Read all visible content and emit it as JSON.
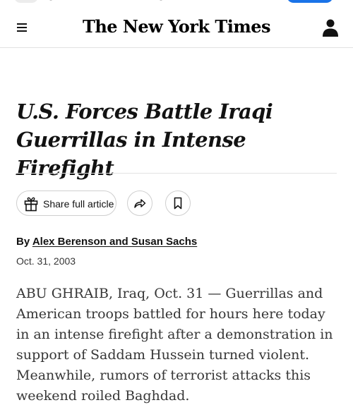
{
  "header": {
    "masthead": "The New York Times",
    "menu_icon": "hamburger-menu-icon",
    "account_icon": "person-icon"
  },
  "article": {
    "headline": "U.S. Forces Battle Iraqi Guerrillas in Intense Firefight",
    "share_button_label": "Share full article",
    "share_icon": "gift-icon",
    "forward_icon": "share-forward-icon",
    "bookmark_icon": "bookmark-icon",
    "byline_prefix": "By",
    "authors": "Alex Berenson and Susan Sachs",
    "date": "Oct. 31, 2003",
    "body": "ABU GHRAIB, Iraq, Oct. 31 — Guerrillas and American troops battled for hours here today in an intense firefight after a demonstration in support of Saddam Hussein turned violent. Meanwhile, rumors of terrorist attacks this weekend roiled Baghdad."
  },
  "colors": {
    "text": "#121212",
    "secondary_text": "#363636",
    "border": "#e2e2e2",
    "accent_button": "#1a73e8"
  }
}
